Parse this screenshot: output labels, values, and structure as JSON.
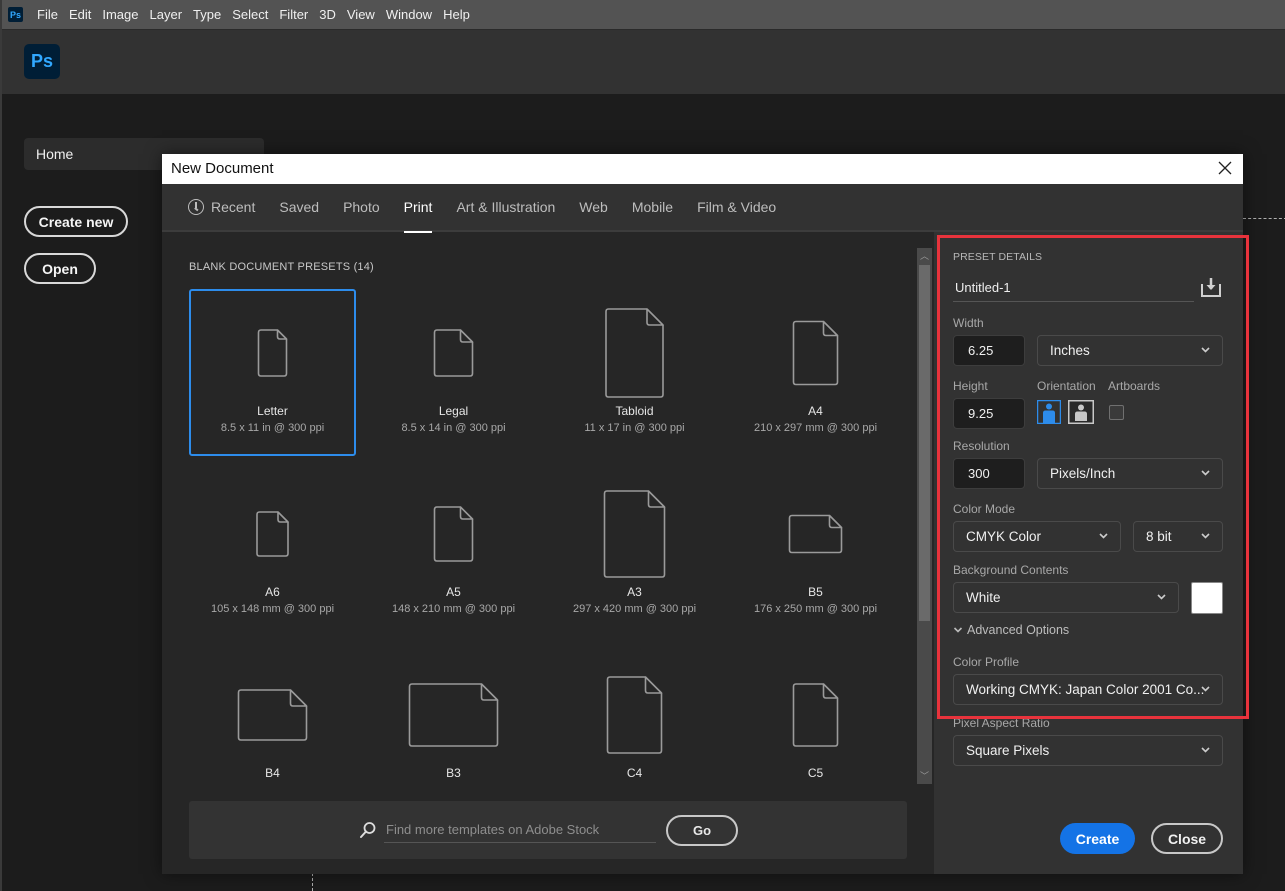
{
  "menubar": {
    "app_icon": "ps-icon",
    "items": [
      "File",
      "Edit",
      "Image",
      "Layer",
      "Type",
      "Select",
      "Filter",
      "3D",
      "View",
      "Window",
      "Help"
    ]
  },
  "app_header": {
    "logo_text": "Ps"
  },
  "home": {
    "tab_label": "Home",
    "create_new_label": "Create new",
    "open_label": "Open"
  },
  "dialog": {
    "title": "New Document",
    "close_icon": "close-icon",
    "tabs": [
      {
        "label": "Recent",
        "icon": "clock-icon",
        "active": false
      },
      {
        "label": "Saved",
        "active": false
      },
      {
        "label": "Photo",
        "active": false
      },
      {
        "label": "Print",
        "active": true
      },
      {
        "label": "Art & Illustration",
        "active": false
      },
      {
        "label": "Web",
        "active": false
      },
      {
        "label": "Mobile",
        "active": false
      },
      {
        "label": "Film & Video",
        "active": false
      }
    ],
    "presets_title": "BLANK DOCUMENT PRESETS",
    "presets_count": "(14)",
    "presets": [
      {
        "name": "Letter",
        "size": "8.5 x 11 in @ 300 ppi",
        "selected": true,
        "shape": [
          28,
          46
        ]
      },
      {
        "name": "Legal",
        "size": "8.5 x 14 in @ 300 ppi",
        "selected": false,
        "shape": [
          38,
          46
        ]
      },
      {
        "name": "Tabloid",
        "size": "11 x 17 in @ 300 ppi",
        "selected": false,
        "shape": [
          57,
          88
        ]
      },
      {
        "name": "A4",
        "size": "210 x 297 mm @ 300 ppi",
        "selected": false,
        "shape": [
          44,
          63
        ]
      },
      {
        "name": "A6",
        "size": "105 x 148 mm @ 300 ppi",
        "selected": false,
        "shape": [
          31,
          44
        ]
      },
      {
        "name": "A5",
        "size": "148 x 210 mm @ 300 ppi",
        "selected": false,
        "shape": [
          38,
          54
        ]
      },
      {
        "name": "A3",
        "size": "297 x 420 mm @ 300 ppi",
        "selected": false,
        "shape": [
          60,
          86
        ]
      },
      {
        "name": "B5",
        "size": "176 x 250 mm @ 300 ppi",
        "selected": false,
        "shape": [
          52,
          37
        ]
      },
      {
        "name": "B4",
        "size": "",
        "selected": false,
        "shape": [
          68,
          50
        ]
      },
      {
        "name": "B3",
        "size": "",
        "selected": false,
        "shape": [
          88,
          62
        ]
      },
      {
        "name": "C4",
        "size": "",
        "selected": false,
        "shape": [
          54,
          76
        ]
      },
      {
        "name": "C5",
        "size": "",
        "selected": false,
        "shape": [
          44,
          62
        ]
      }
    ],
    "stock_search": {
      "placeholder": "Find more templates on Adobe Stock",
      "value": "",
      "go_label": "Go"
    },
    "preset_details": {
      "section_title": "PRESET DETAILS",
      "document_name": "Untitled-1",
      "save_preset_icon": "save-preset-icon",
      "width_label": "Width",
      "width_value": "6.25",
      "width_unit": "Inches",
      "height_label": "Height",
      "height_value": "9.25",
      "orientation_label": "Orientation",
      "orientation": "portrait",
      "artboards_label": "Artboards",
      "artboards_checked": false,
      "resolution_label": "Resolution",
      "resolution_value": "300",
      "resolution_unit": "Pixels/Inch",
      "color_mode_label": "Color Mode",
      "color_mode": "CMYK Color",
      "bit_depth": "8 bit",
      "background_label": "Background Contents",
      "background": "White",
      "background_swatch": "#ffffff",
      "advanced_label": "Advanced Options",
      "color_profile_label": "Color Profile",
      "color_profile": "Working CMYK: Japan Color 2001 Co...",
      "pixel_aspect_label": "Pixel Aspect Ratio",
      "pixel_aspect": "Square Pixels",
      "create_label": "Create",
      "close_label": "Close"
    }
  },
  "colors": {
    "accent": "#1473e6",
    "selection": "#2d8ceb",
    "highlight_box": "#e8333c",
    "ps_blue": "#31a8ff",
    "ps_navy": "#001e36"
  }
}
